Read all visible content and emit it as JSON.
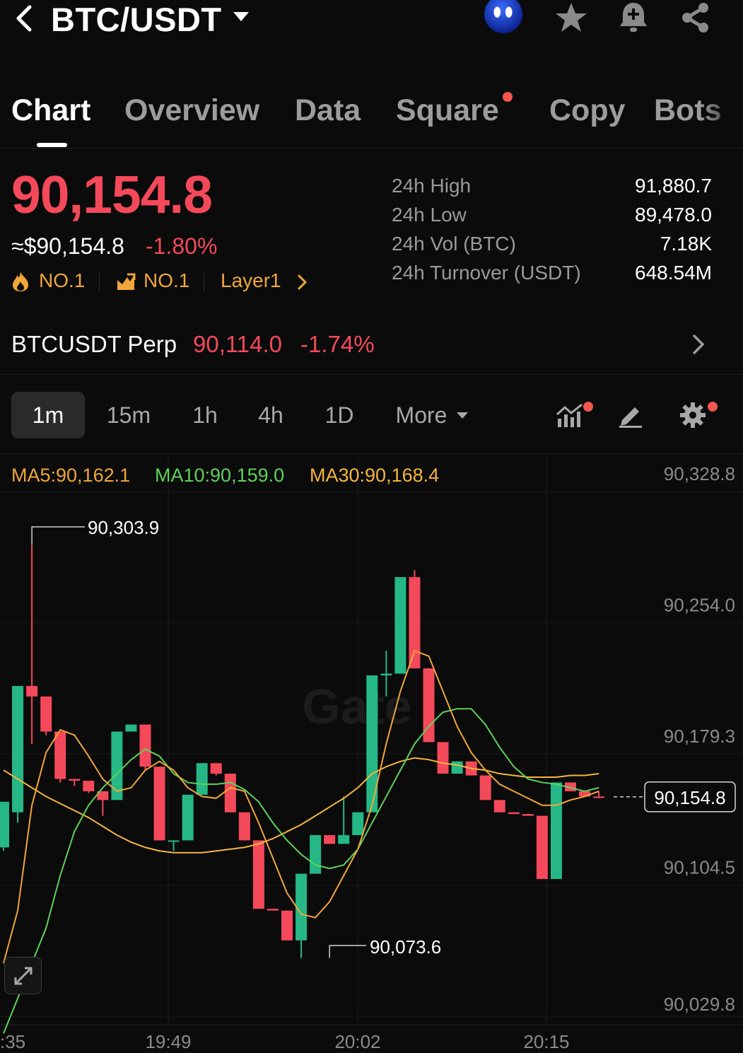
{
  "header": {
    "pair": "BTC/USDT",
    "icons": [
      "back-chevron-icon",
      "caret-down-icon",
      "avatar-bot-icon",
      "star-icon",
      "bell-plus-icon",
      "share-icon"
    ]
  },
  "tabs": [
    {
      "label": "Chart",
      "active": true
    },
    {
      "label": "Overview"
    },
    {
      "label": "Data"
    },
    {
      "label": "Square",
      "dot": true
    },
    {
      "label": "Copy"
    },
    {
      "label": "Bots"
    }
  ],
  "price": {
    "last": "90,154.8",
    "usd": "≈$90,154.8",
    "change": "-1.80%",
    "tags": [
      "NO.1",
      "NO.1",
      "Layer1"
    ]
  },
  "stats": [
    {
      "label": "24h High",
      "value": "91,880.7"
    },
    {
      "label": "24h Low",
      "value": "89,478.0"
    },
    {
      "label": "24h Vol (BTC)",
      "value": "7.18K"
    },
    {
      "label": "24h Turnover (USDT)",
      "value": "648.54M"
    }
  ],
  "perp": {
    "name": "BTCUSDT Perp",
    "price": "90,114.0",
    "change": "-1.74%"
  },
  "timeframes": [
    {
      "label": "1m",
      "active": true
    },
    {
      "label": "15m"
    },
    {
      "label": "1h"
    },
    {
      "label": "4h"
    },
    {
      "label": "1D"
    },
    {
      "label": "More"
    }
  ],
  "ma": {
    "ma5": "MA5:90,162.1",
    "ma10": "MA10:90,159.0",
    "ma30": "MA30:90,168.4"
  },
  "colors": {
    "up": "#25b886",
    "down": "#f4495a",
    "ma5": "#f0a63a",
    "ma10": "#5fd15a",
    "ma30": "#f5b63c",
    "accent": "#f4554f"
  },
  "chart_data": {
    "type": "candlestick",
    "ylim": [
      90029.8,
      90328.8
    ],
    "y_ticks": [
      "90,328.8",
      "90,254.0",
      "90,179.3",
      "90,104.5",
      "90,029.8"
    ],
    "x_ticks": [
      ":35",
      "19:49",
      "20:02",
      "20:15"
    ],
    "high_label": "90,303.9",
    "low_label": "90,073.6",
    "current_label": "90,154.8",
    "watermark": "Gate",
    "candles": [
      {
        "o": 90126,
        "h": 90152,
        "c": 90152,
        "l": 90124
      },
      {
        "o": 90146,
        "h": 90218,
        "c": 90218,
        "l": 90140
      },
      {
        "o": 90218,
        "h": 90298,
        "c": 90212,
        "l": 90185
      },
      {
        "o": 90212,
        "h": 90212,
        "c": 90192,
        "l": 90190
      },
      {
        "o": 90192,
        "h": 90192,
        "c": 90165,
        "l": 90163
      },
      {
        "o": 90165,
        "h": 90165,
        "c": 90164,
        "l": 90161
      },
      {
        "o": 90164,
        "h": 90164,
        "c": 90158,
        "l": 90157
      },
      {
        "o": 90158,
        "h": 90158,
        "c": 90153,
        "l": 90144
      },
      {
        "o": 90153,
        "h": 90192,
        "c": 90192,
        "l": 90153
      },
      {
        "o": 90192,
        "h": 90196,
        "c": 90196,
        "l": 90192
      },
      {
        "o": 90196,
        "h": 90196,
        "c": 90172,
        "l": 90170
      },
      {
        "o": 90172,
        "h": 90172,
        "c": 90130,
        "l": 90130
      },
      {
        "o": 90130,
        "h": 90130,
        "c": 90130,
        "l": 90124
      },
      {
        "o": 90130,
        "h": 90156,
        "c": 90156,
        "l": 90130
      },
      {
        "o": 90156,
        "h": 90174,
        "c": 90174,
        "l": 90156
      },
      {
        "o": 90174,
        "h": 90174,
        "c": 90168,
        "l": 90167
      },
      {
        "o": 90168,
        "h": 90168,
        "c": 90146,
        "l": 90146
      },
      {
        "o": 90146,
        "h": 90146,
        "c": 90130,
        "l": 90130
      },
      {
        "o": 90130,
        "h": 90130,
        "c": 90091,
        "l": 90091
      },
      {
        "o": 90091,
        "h": 90091,
        "c": 90090,
        "l": 90090
      },
      {
        "o": 90090,
        "h": 90090,
        "c": 90073,
        "l": 90073
      },
      {
        "o": 90073,
        "h": 90111,
        "c": 90111,
        "l": 90063
      },
      {
        "o": 90111,
        "h": 90133,
        "c": 90133,
        "l": 90111
      },
      {
        "o": 90133,
        "h": 90133,
        "c": 90128,
        "l": 90128
      },
      {
        "o": 90128,
        "h": 90155,
        "c": 90133,
        "l": 90130
      },
      {
        "o": 90133,
        "h": 90146,
        "c": 90146,
        "l": 90133
      },
      {
        "o": 90146,
        "h": 90224,
        "c": 90224,
        "l": 90146
      },
      {
        "o": 90224,
        "h": 90238,
        "c": 90225,
        "l": 90212
      },
      {
        "o": 90225,
        "h": 90280,
        "c": 90280,
        "l": 90225
      },
      {
        "o": 90280,
        "h": 90284,
        "c": 90228,
        "l": 90228
      },
      {
        "o": 90228,
        "h": 90228,
        "c": 90186,
        "l": 90186
      },
      {
        "o": 90186,
        "h": 90186,
        "c": 90168,
        "l": 90168
      },
      {
        "o": 90168,
        "h": 90175,
        "c": 90175,
        "l": 90168
      },
      {
        "o": 90175,
        "h": 90175,
        "c": 90167,
        "l": 90167
      },
      {
        "o": 90167,
        "h": 90167,
        "c": 90153,
        "l": 90153
      },
      {
        "o": 90153,
        "h": 90153,
        "c": 90146,
        "l": 90146
      },
      {
        "o": 90146,
        "h": 90146,
        "c": 90145,
        "l": 90145
      },
      {
        "o": 90145,
        "h": 90145,
        "c": 90144,
        "l": 90144
      },
      {
        "o": 90144,
        "h": 90144,
        "c": 90108,
        "l": 90108
      },
      {
        "o": 90108,
        "h": 90163,
        "c": 90163,
        "l": 90108
      },
      {
        "o": 90163,
        "h": 90163,
        "c": 90158,
        "l": 90158
      },
      {
        "o": 90158,
        "h": 90158,
        "c": 90155,
        "l": 90155
      },
      {
        "o": 90155,
        "h": 90158,
        "c": 90154.8,
        "l": 90154
      }
    ],
    "ma5": [
      90060,
      90090,
      90150,
      90180,
      90193,
      90190,
      90178,
      90165,
      90158,
      90160,
      90170,
      90175,
      90170,
      90160,
      90155,
      90154,
      90160,
      90158,
      90140,
      90120,
      90100,
      90088,
      90086,
      90095,
      90110,
      90125,
      90150,
      90185,
      90215,
      90238,
      90235,
      90215,
      90195,
      90180,
      90170,
      90162,
      90158,
      90154,
      90150,
      90150,
      90153,
      90155,
      90158
    ],
    "ma10": [
      90020,
      90040,
      90060,
      90080,
      90110,
      90135,
      90150,
      90160,
      90168,
      90176,
      90182,
      90178,
      90168,
      90163,
      90162,
      90162,
      90163,
      90159,
      90152,
      90140,
      90130,
      90122,
      90116,
      90114,
      90116,
      90125,
      90140,
      90155,
      90170,
      90185,
      90195,
      90203,
      90205,
      90205,
      90196,
      90183,
      90172,
      90165,
      90163,
      90162,
      90160,
      90158,
      90160
    ],
    "ma30": [
      90170,
      90165,
      90160,
      90155,
      90151,
      90147,
      90143,
      90138,
      90133,
      90129,
      90126,
      90124,
      90123,
      90123,
      90123,
      90124,
      90125,
      90126,
      90128,
      90131,
      90135,
      90139,
      90144,
      90149,
      90154,
      90160,
      90168,
      90172,
      90175,
      90177,
      90176,
      90174,
      90173,
      90171,
      90170,
      90168,
      90167,
      90166,
      90166,
      90166,
      90167,
      90167,
      90168
    ]
  }
}
